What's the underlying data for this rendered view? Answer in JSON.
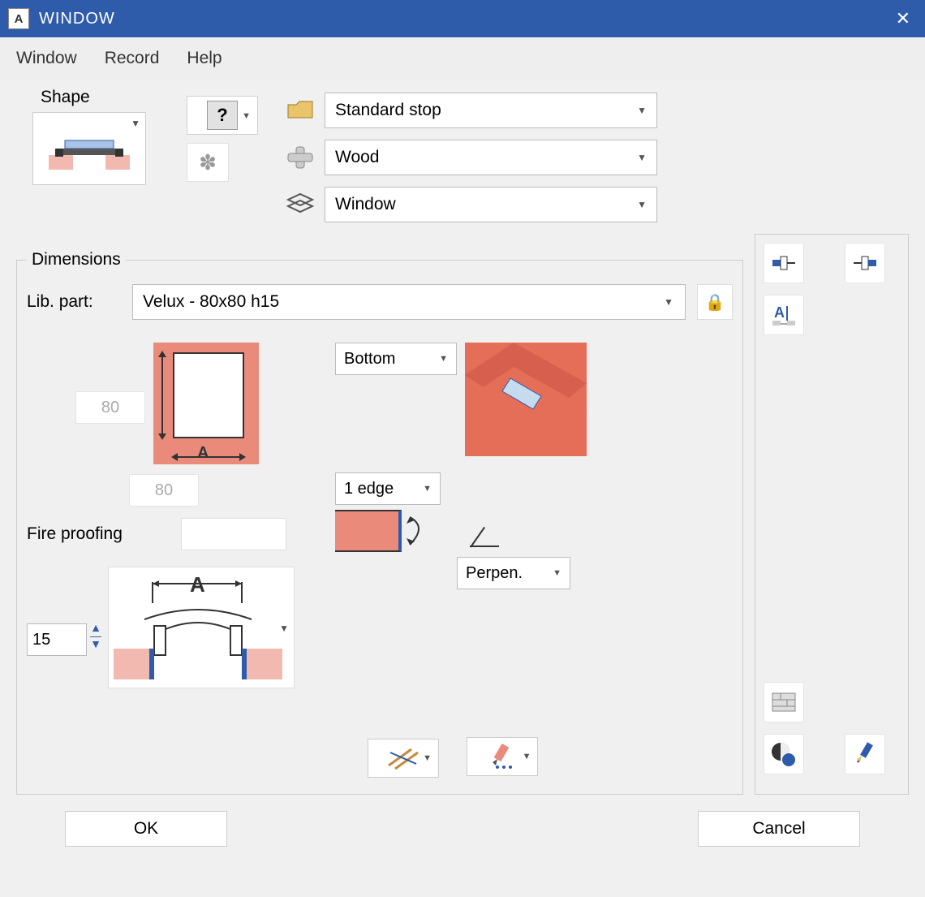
{
  "title": "WINDOW",
  "menu": {
    "window": "Window",
    "record": "Record",
    "help": "Help"
  },
  "shape_label": "Shape",
  "props": {
    "stop": "Standard stop",
    "material": "Wood",
    "layer": "Window"
  },
  "dimensions_label": "Dimensions",
  "libpart": {
    "label": "Lib. part:",
    "value": "Velux - 80x80 h15"
  },
  "dim_w": "80",
  "dim_h": "80",
  "dim_z": "15",
  "fire_label": "Fire proofing",
  "fire_value": "",
  "ref": {
    "bottom": "Bottom",
    "edge": "1 edge",
    "perp": "Perpen."
  },
  "buttons": {
    "ok": "OK",
    "cancel": "Cancel"
  }
}
